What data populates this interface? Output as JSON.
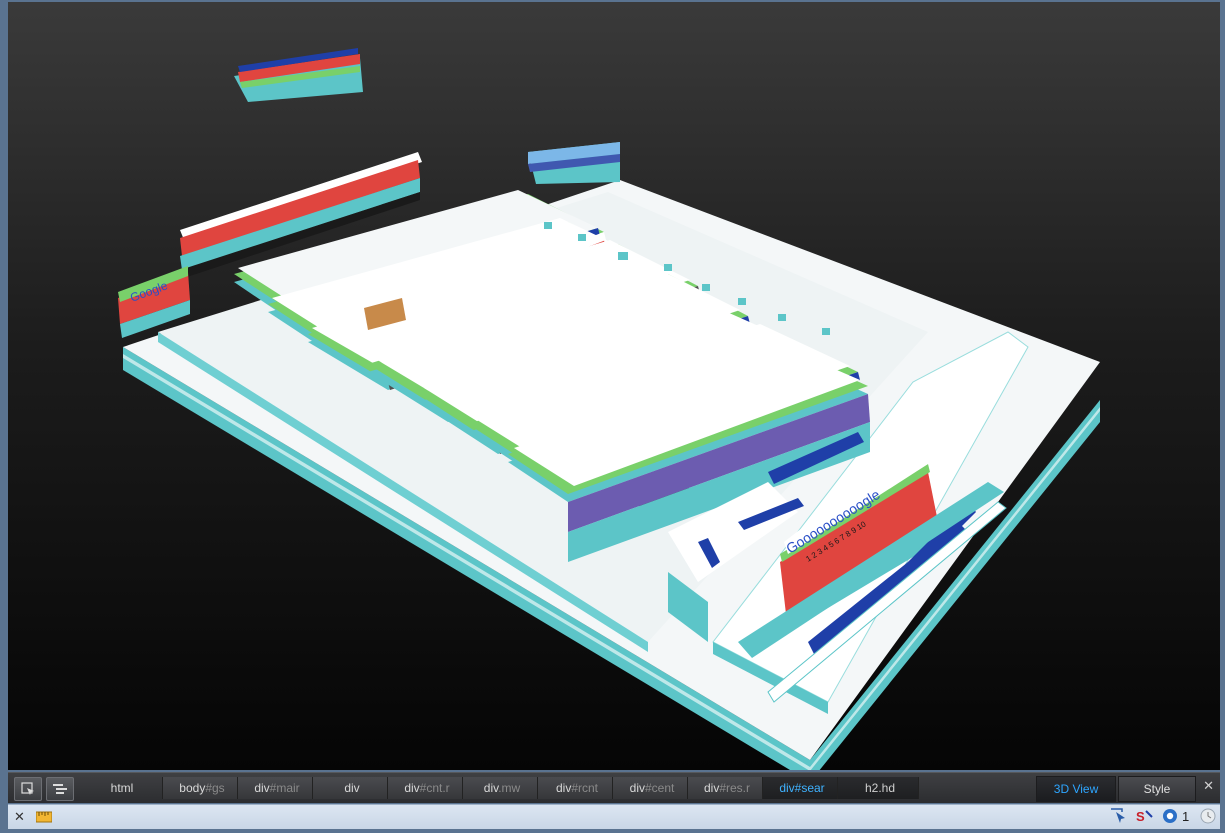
{
  "breadcrumbs": [
    {
      "main": "html",
      "dim": ""
    },
    {
      "main": "body",
      "dim": "#gs"
    },
    {
      "main": "div",
      "dim": "#mair"
    },
    {
      "main": "div",
      "dim": ""
    },
    {
      "main": "div",
      "dim": "#cnt.r"
    },
    {
      "main": "div",
      "dim": ".mw"
    },
    {
      "main": "div",
      "dim": "#rcnt"
    },
    {
      "main": "div",
      "dim": "#cent"
    },
    {
      "main": "div",
      "dim": "#res.r"
    },
    {
      "main": "div#sear",
      "dim": ""
    },
    {
      "main": "h2.hd",
      "dim": ""
    }
  ],
  "toolbar": {
    "view_3d_label": "3D View",
    "style_label": "Style",
    "close_label": "✕"
  },
  "statusbar": {
    "close_label": "✕",
    "count_label": "1"
  },
  "icons": {
    "select": "select-element-icon",
    "tree": "dom-tree-icon",
    "ruler": "ruler-icon",
    "cursor": "inspect-cursor-icon",
    "script": "script-debug-icon",
    "info": "info-icon",
    "clock": "clock-icon"
  },
  "scene": {
    "logo_text": "Google",
    "paging_letters": "Goooooooooogle",
    "page_numbers": "1 2 3 4 5 6 7 8 9 10",
    "colors": {
      "teal": "#5cc5c8",
      "white": "#f4f7f8",
      "red": "#e0453f",
      "green": "#79d06a",
      "blue": "#1f3fa8",
      "gray": "#505050"
    }
  }
}
